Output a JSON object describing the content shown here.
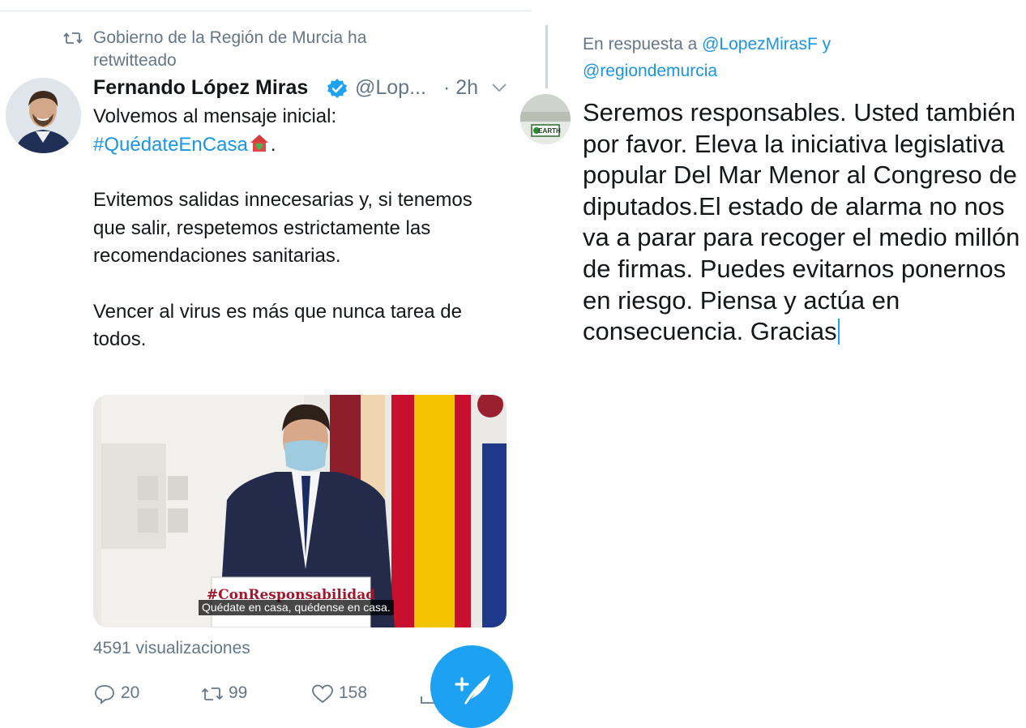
{
  "retweet": {
    "icon": "retweet-icon",
    "label": "Gobierno de la Región de Murcia ha retwitteado"
  },
  "tweet": {
    "author_name": "Fernando López Miras",
    "verified_icon": "verified-badge-icon",
    "handle": "@Lop...",
    "time": "· 2h",
    "menu_icon": "chevron-down-icon",
    "line1": "Volvemos al mensaje inicial:",
    "hashtag": "#QuédateEnCasa",
    "hashtag_suffix": ".",
    "paragraph2": "Evitemos salidas innecesarias y, si tenemos que salir, respetemos estrictamente las recomendaciones sanitarias.",
    "paragraph3": "Vencer al virus es más que nunca tarea de todos.",
    "video_caption": "Quédate en casa, quédense en casa.",
    "video_sign_text": "#ConResponsabilidad",
    "views": "4591 visualizaciones",
    "actions": {
      "reply_count": "20",
      "retweet_count": "99",
      "like_count": "158"
    }
  },
  "fab": {
    "icon": "compose-tweet-icon"
  },
  "reply": {
    "prefix": "En respuesta a",
    "mention1": "@LopezMirasF",
    "joiner": "y",
    "mention2": "@regiondemurcia",
    "avatar_label": "EARTH",
    "body": "Seremos responsables. Usted también por favor. Eleva la iniciativa legislativa popular Del Mar Menor al Congreso de diputados.El estado de alarma no nos va a parar para recoger el medio millón de firmas. Puedes evitarnos ponernos en riesgo. Piensa y actúa en consecuencia. Gracias"
  },
  "colors": {
    "link": "#1b95e0",
    "muted": "#657786",
    "fab": "#1da1f2",
    "heart_red": "#e0245e"
  }
}
